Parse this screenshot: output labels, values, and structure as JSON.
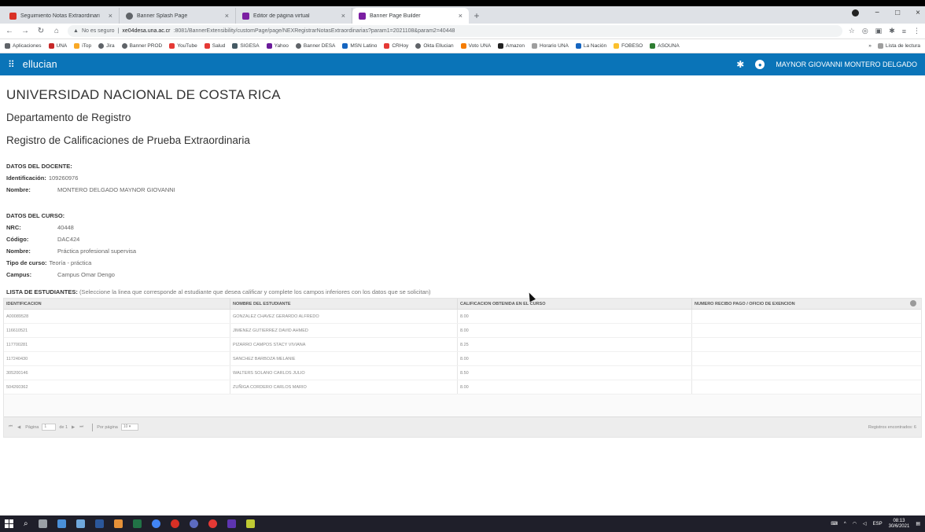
{
  "browser": {
    "tabs": [
      {
        "label": "Seguimiento Notas Extraordinari",
        "color": "#d93025",
        "active": false
      },
      {
        "label": "Banner Splash Page",
        "color": "#5f6368",
        "active": false
      },
      {
        "label": "Editor de página virtual",
        "color": "#7b1fa2",
        "active": false
      },
      {
        "label": "Banner Page Builder",
        "color": "#7b1fa2",
        "active": true
      }
    ],
    "new_tab": "+",
    "window_controls": [
      "−",
      "□",
      "×"
    ],
    "security_label": "No es seguro",
    "url_host": "xe04desa.una.ac.cr",
    "url_path": ":8081/BannerExtensibility/customPage/page/NEXRegistrarNotasExtraordinarias?param1=2021108&param2=40448",
    "bookmarks": [
      {
        "label": "Aplicaciones",
        "color": "#5f6368"
      },
      {
        "label": "UNA",
        "color": "#c62828"
      },
      {
        "label": "iTop",
        "color": "#f9a825"
      },
      {
        "label": "Jira",
        "color": "#5f6368"
      },
      {
        "label": "Banner PROD",
        "color": "#5f6368"
      },
      {
        "label": "YouTube",
        "color": "#e53935"
      },
      {
        "label": "Salud",
        "color": "#e53935"
      },
      {
        "label": "SIGESA",
        "color": "#455a64"
      },
      {
        "label": "Yahoo",
        "color": "#6a1b9a"
      },
      {
        "label": "Banner DESA",
        "color": "#5f6368"
      },
      {
        "label": "MSN Latino",
        "color": "#1565c0"
      },
      {
        "label": "CRHoy",
        "color": "#e53935"
      },
      {
        "label": "Okta Ellucian",
        "color": "#5f6368"
      },
      {
        "label": "Voto UNA",
        "color": "#f57c00"
      },
      {
        "label": "Amazon",
        "color": "#212121"
      },
      {
        "label": "Horario UNA",
        "color": "#9e9e9e"
      },
      {
        "label": "La Nación",
        "color": "#1565c0"
      },
      {
        "label": "FOBESO",
        "color": "#fbc02d"
      },
      {
        "label": "ASOUNA",
        "color": "#2e7d32"
      }
    ],
    "reading_list": "Lista de lectura"
  },
  "app": {
    "brand": "ellucian",
    "user_name": "MAYNOR GIOVANNI MONTERO DELGADO"
  },
  "page": {
    "title": "UNIVERSIDAD NACIONAL DE COSTA RICA",
    "subtitle": "Departamento de Registro",
    "heading": "Registro de Calificaciones de Prueba Extraordinaria"
  },
  "docente": {
    "section_title": "DATOS DEL DOCENTE:",
    "id_label": "Identificación:",
    "id_value": "109260976",
    "name_label": "Nombre:",
    "name_value": "MONTERO DELGADO MAYNOR GIOVANNI"
  },
  "curso": {
    "section_title": "DATOS DEL CURSO:",
    "fields": [
      {
        "label": "NRC:",
        "value": "40448"
      },
      {
        "label": "Código:",
        "value": "DAC424"
      },
      {
        "label": "Nombre:",
        "value": "Práctica profesional supervisa"
      },
      {
        "label": "Tipo de curso:",
        "value": "Teoría - práctica"
      },
      {
        "label": "Campus:",
        "value": "Campus Omar Dengo"
      }
    ]
  },
  "students": {
    "section_title": "LISTA DE ESTUDIANTES:",
    "hint": "(Seleccione la linea que corresponde al estudiante que desea calificar y complete los campos inferiores con los datos que se solicitan)",
    "columns": [
      "IDENTIFICACION",
      "NOMBRE DEL ESTUDIANTE",
      "CALIFICACION OBTENIDA EN EL CURSO",
      "NUMERO RECIBO PAGO / OFICIO DE EXENCION"
    ],
    "rows": [
      {
        "id": "A00089528",
        "name": "GONZALEZ CHAVEZ GERARDO ALFREDO",
        "grade": "8.00",
        "receipt": ""
      },
      {
        "id": "116610521",
        "name": "JIMENEZ GUTIERREZ DAVID AHMED",
        "grade": "8.00",
        "receipt": ""
      },
      {
        "id": "117700281",
        "name": "PIZARRO CAMPOS STACY VIVIANA",
        "grade": "8.25",
        "receipt": ""
      },
      {
        "id": "117240430",
        "name": "SANCHEZ BARBOZA MELANIE",
        "grade": "8.00",
        "receipt": ""
      },
      {
        "id": "305200146",
        "name": "WALTERS SOLANO CARLOS JULIO",
        "grade": "8.50",
        "receipt": ""
      },
      {
        "id": "504260362",
        "name": "ZUÑIGA CORDERO CARLOS MARIO",
        "grade": "8.00",
        "receipt": ""
      }
    ]
  },
  "pager": {
    "page_label": "Página",
    "page_value": "1",
    "of_label": "de 1",
    "per_page_label": "Por página",
    "per_page_value": "10",
    "records_found": "Registros encontrados: 6"
  },
  "taskbar": {
    "language": "ESP",
    "time": "08:13",
    "date": "30/6/2021"
  }
}
